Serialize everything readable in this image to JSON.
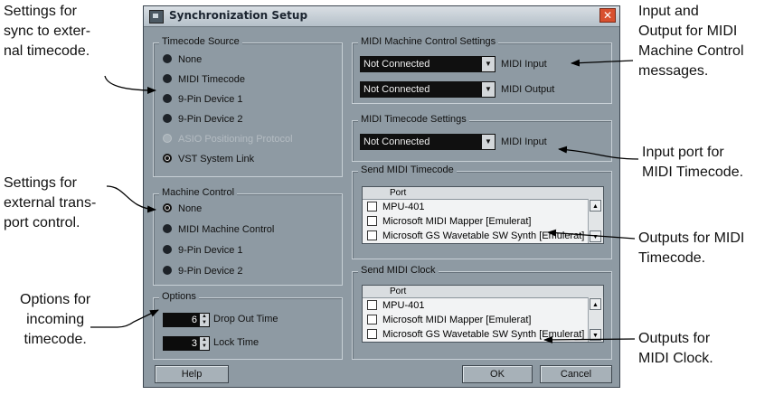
{
  "annotations": {
    "sync_timecode": [
      "Settings for",
      "sync to exter-",
      "nal timecode."
    ],
    "transport_control": [
      "Settings for",
      "external trans-",
      "port control."
    ],
    "incoming_timecode": [
      "Options for",
      "incoming",
      "timecode."
    ],
    "mmc_io": [
      "Input and",
      "Output for MIDI",
      "Machine Control",
      "messages."
    ],
    "mtc_input": [
      "Input port for",
      "MIDI Timecode."
    ],
    "outputs_mtc": [
      "Outputs for MIDI",
      "Timecode."
    ],
    "outputs_clock": [
      "Outputs for",
      "MIDI Clock."
    ]
  },
  "dialog": {
    "title": "Synchronization Setup",
    "close_glyph": "✕",
    "timecode_source": {
      "legend": "Timecode Source",
      "options": [
        "None",
        "MIDI Timecode",
        "9-Pin Device 1",
        "9-Pin Device 2",
        "ASIO Positioning Protocol",
        "VST System Link"
      ],
      "selected": "VST System Link"
    },
    "machine_control": {
      "legend": "Machine Control",
      "options": [
        "None",
        "MIDI Machine Control",
        "9-Pin Device 1",
        "9-Pin Device 2"
      ],
      "selected": "None"
    },
    "options": {
      "legend": "Options",
      "drop_out_value": "6",
      "drop_out_label": "Drop Out Time",
      "lock_value": "3",
      "lock_label": "Lock Time"
    },
    "mmc_settings": {
      "legend": "MIDI Machine Control Settings",
      "input_value": "Not Connected",
      "input_label": "MIDI Input",
      "output_value": "Not Connected",
      "output_label": "MIDI Output"
    },
    "mtc_settings": {
      "legend": "MIDI Timecode Settings",
      "input_value": "Not Connected",
      "input_label": "MIDI Input"
    },
    "send_mtc": {
      "legend": "Send MIDI Timecode",
      "column": "Port",
      "ports": [
        "MPU-401",
        "Microsoft MIDI Mapper [Emulerat]",
        "Microsoft GS Wavetable SW Synth [Emulerat]"
      ]
    },
    "send_clock": {
      "legend": "Send MIDI Clock",
      "column": "Port",
      "ports": [
        "MPU-401",
        "Microsoft MIDI Mapper [Emulerat]",
        "Microsoft GS Wavetable SW Synth [Emulerat]"
      ]
    },
    "buttons": {
      "help": "Help",
      "ok": "OK",
      "cancel": "Cancel"
    }
  }
}
